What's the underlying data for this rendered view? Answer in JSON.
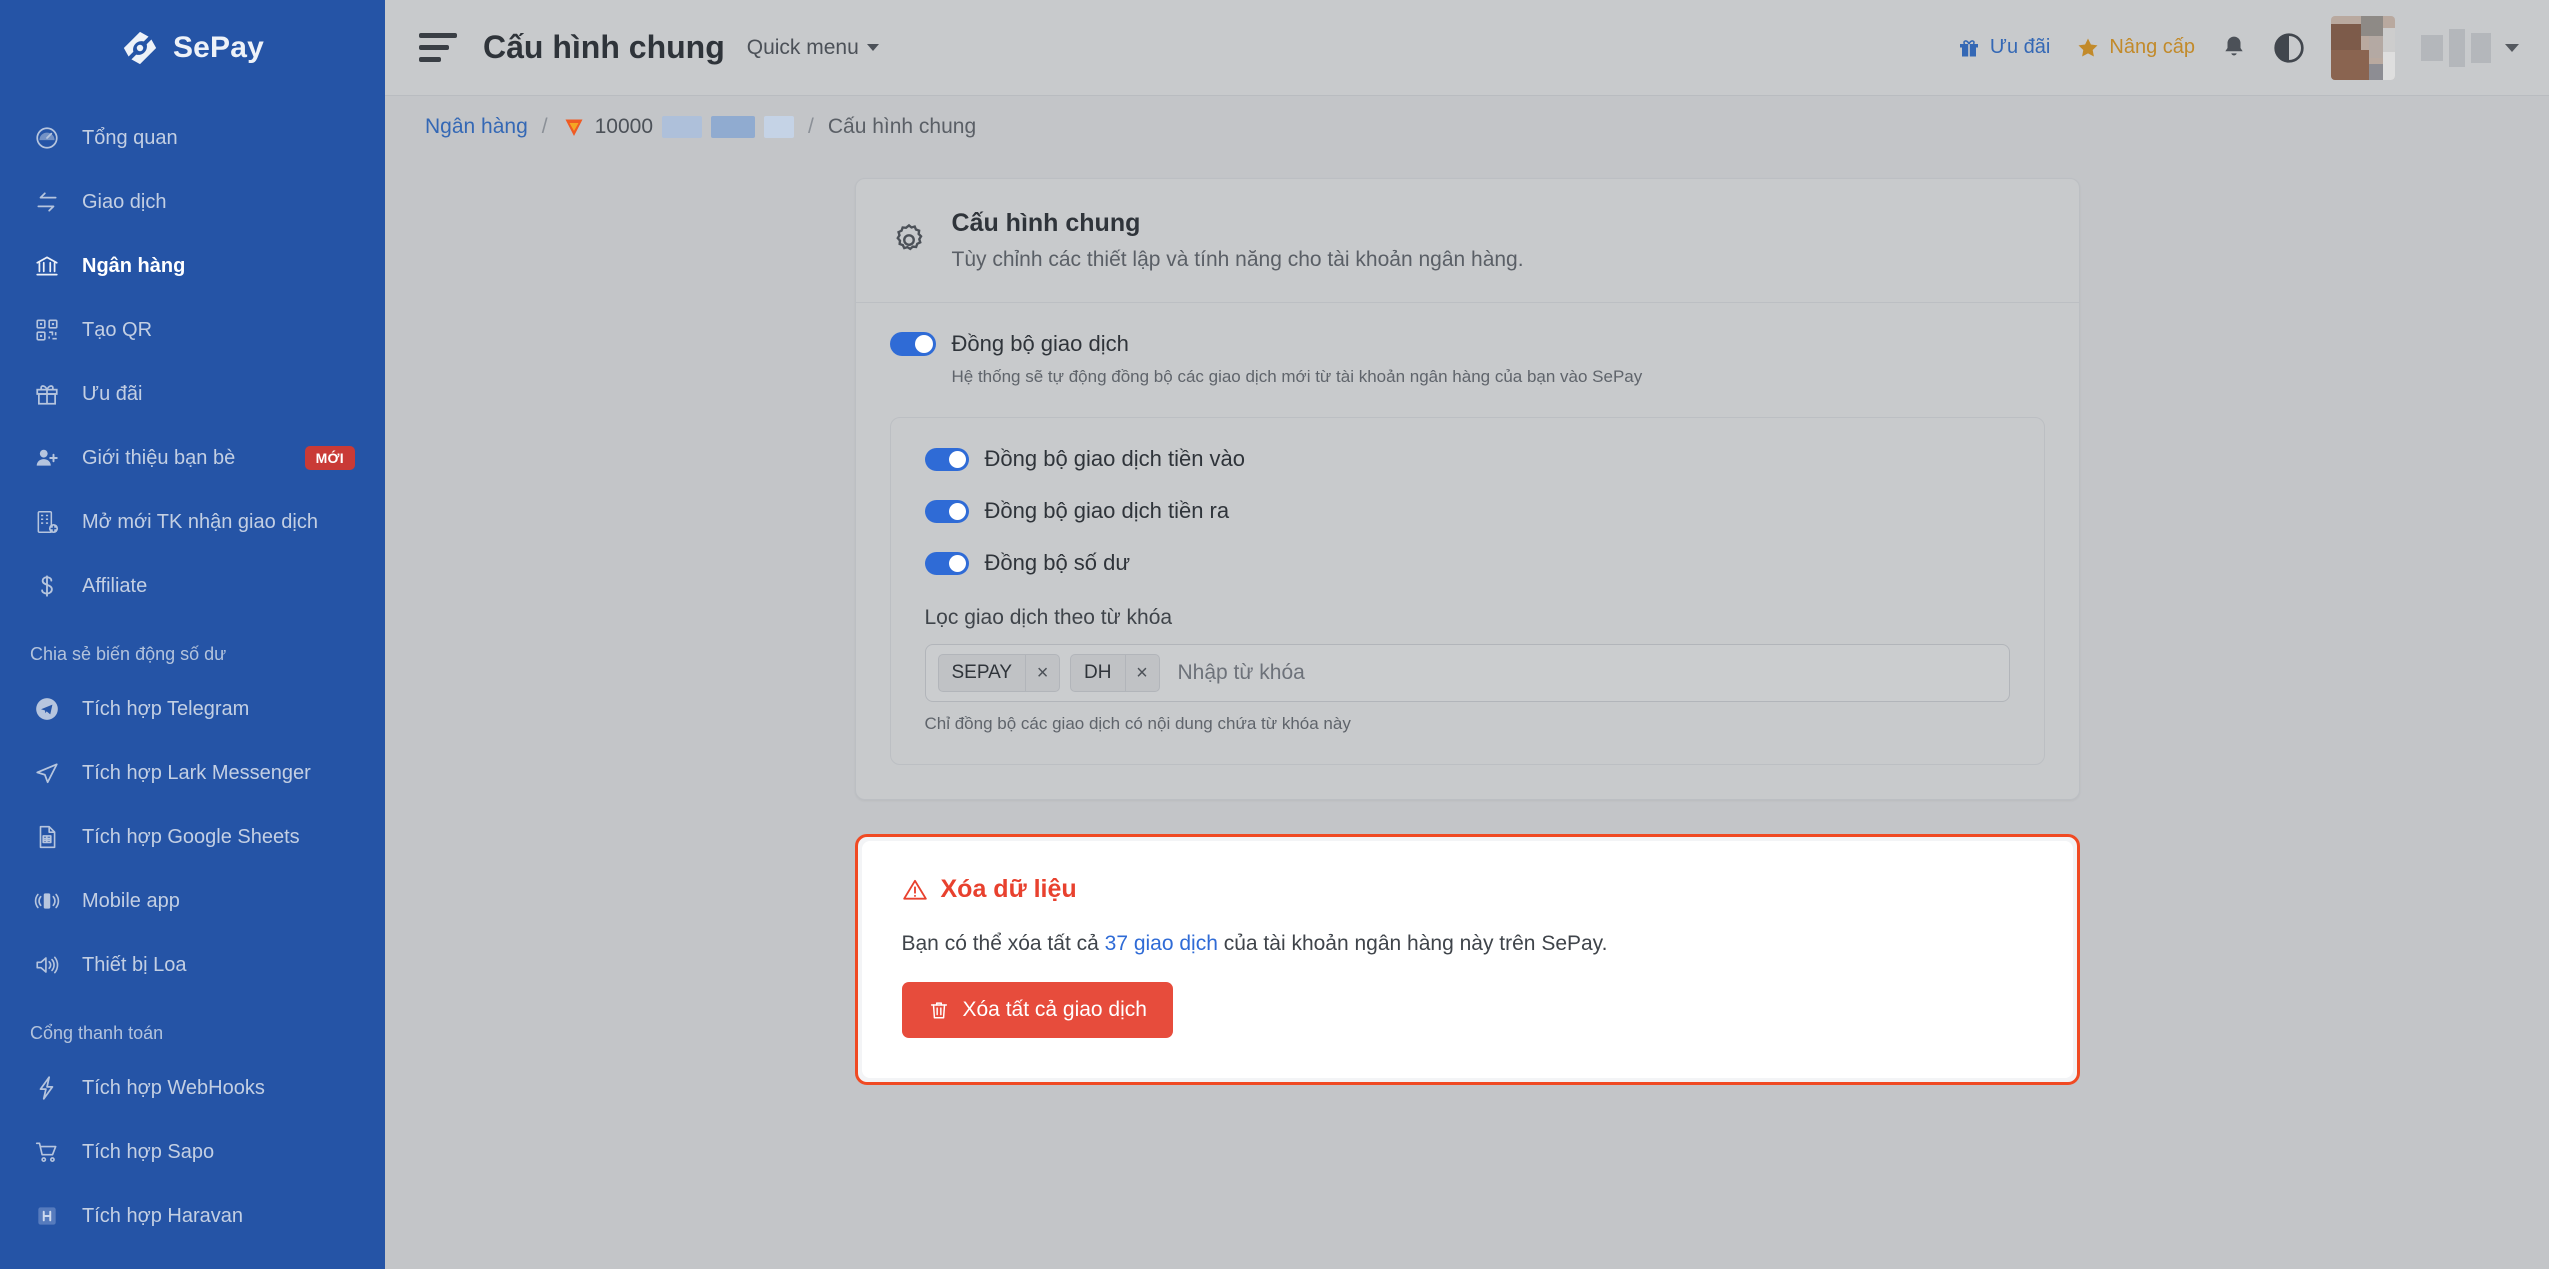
{
  "brand": {
    "name": "SePay",
    "logo_icon": "sepay-logo-icon"
  },
  "sidebar": {
    "items": [
      {
        "label": "Tổng quan",
        "icon": "dashboard-icon",
        "active": false
      },
      {
        "label": "Giao dịch",
        "icon": "transactions-icon",
        "active": false
      },
      {
        "label": "Ngân hàng",
        "icon": "bank-icon",
        "active": true
      },
      {
        "label": "Tạo QR",
        "icon": "qr-code-icon",
        "active": false
      },
      {
        "label": "Ưu đãi",
        "icon": "gift-icon",
        "active": false
      },
      {
        "label": "Giới thiệu bạn bè",
        "icon": "user-plus-icon",
        "active": false,
        "badge": "MỚI"
      },
      {
        "label": "Mở mới TK nhận giao dịch",
        "icon": "new-account-icon",
        "active": false
      },
      {
        "label": "Affiliate",
        "icon": "dollar-icon",
        "active": false
      }
    ],
    "section_balance": {
      "title": "Chia sẻ biến động số dư",
      "items": [
        {
          "label": "Tích hợp Telegram",
          "icon": "telegram-icon"
        },
        {
          "label": "Tích hợp Lark Messenger",
          "icon": "lark-icon"
        },
        {
          "label": "Tích hợp Google Sheets",
          "icon": "google-sheets-icon"
        },
        {
          "label": "Mobile app",
          "icon": "mobile-app-icon"
        },
        {
          "label": "Thiết bị Loa",
          "icon": "speaker-icon"
        }
      ]
    },
    "section_payment": {
      "title": "Cổng thanh toán",
      "items": [
        {
          "label": "Tích hợp WebHooks",
          "icon": "webhook-icon"
        },
        {
          "label": "Tích hợp Sapo",
          "icon": "cart-icon"
        },
        {
          "label": "Tích hợp Haravan",
          "icon": "haravan-icon"
        }
      ]
    }
  },
  "topbar": {
    "menu_icon": "hamburger-menu-icon",
    "title": "Cấu hình chung",
    "quick_menu": "Quick menu",
    "promo_label": "Ưu đãi",
    "promo_icon": "gift-icon",
    "upgrade_label": "Nâng cấp",
    "upgrade_icon": "star-icon",
    "bell_icon": "notification-bell-icon",
    "theme_icon": "theme-contrast-icon",
    "avatar_icon": "user-avatar",
    "caret_icon": "chevron-down-icon"
  },
  "breadcrumb": {
    "root": "Ngân hàng",
    "separator": "/",
    "bank_icon": "vpbank-icon",
    "bank_account": "10000",
    "current": "Cấu hình chung"
  },
  "main_card": {
    "icon": "gear-icon",
    "title": "Cấu hình chung",
    "subtitle": "Tùy chỉnh các thiết lập và tính năng cho tài khoản ngân hàng.",
    "sync": {
      "label": "Đồng bộ giao dịch",
      "enabled": true,
      "description": "Hệ thống sẽ tự động đồng bộ các giao dịch mới từ tài khoản ngân hàng của bạn vào SePay"
    },
    "sub_toggles": [
      {
        "label": "Đồng bộ giao dịch tiền vào",
        "enabled": true
      },
      {
        "label": "Đồng bộ giao dịch tiền ra",
        "enabled": true
      },
      {
        "label": "Đồng bộ số dư",
        "enabled": true
      }
    ],
    "keyword_filter": {
      "label": "Lọc giao dịch theo từ khóa",
      "tags": [
        "SEPAY",
        "DH"
      ],
      "remove_symbol": "×",
      "placeholder": "Nhập từ khóa",
      "hint": "Chỉ đồng bộ các giao dịch có nội dung chứa từ khóa này"
    }
  },
  "danger_zone": {
    "warn_icon": "warning-triangle-icon",
    "title": "Xóa dữ liệu",
    "text_before": "Bạn có thể xóa tất cả ",
    "link_text": "37 giao dịch",
    "text_after": " của tài khoản ngân hàng này trên SePay.",
    "button_label": "Xóa tất cả giao dịch",
    "button_icon": "trash-icon",
    "border_color": "#f04a23",
    "button_color": "#e74c3c"
  },
  "colors": {
    "sidebar_blue": "#2554a6",
    "accent_blue": "#2f6bd6",
    "danger_red": "#e74c3c",
    "upgrade_gold": "#c28a2a"
  }
}
